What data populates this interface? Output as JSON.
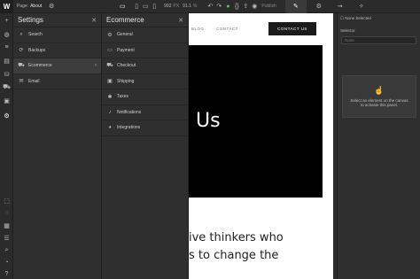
{
  "topbar": {
    "logo": "W",
    "page_prefix": "Page:",
    "page_name": "About",
    "width": "992",
    "px": "PX",
    "zoom": "91.1",
    "percent": "%",
    "publish_label": "Publish"
  },
  "settings_panel": {
    "title": "Settings",
    "items": [
      {
        "label": "Search",
        "icon": "search-icon"
      },
      {
        "label": "Backups",
        "icon": "backups-icon"
      },
      {
        "label": "Ecommerce",
        "icon": "cart-icon"
      },
      {
        "label": "Email",
        "icon": "email-icon"
      }
    ]
  },
  "ecommerce_panel": {
    "title": "Ecommerce",
    "items": [
      {
        "label": "General",
        "icon": "gear-icon"
      },
      {
        "label": "Payment",
        "icon": "payment-icon"
      },
      {
        "label": "Checkout",
        "icon": "checkout-icon"
      },
      {
        "label": "Shipping",
        "icon": "shipping-icon"
      },
      {
        "label": "Taxes",
        "icon": "taxes-icon"
      },
      {
        "label": "Notifications",
        "icon": "bell-icon"
      },
      {
        "label": "Integrations",
        "icon": "integrations-icon"
      }
    ]
  },
  "canvas": {
    "nav_blog": "BLOG",
    "nav_contact": "CONTACT",
    "cta": "CONTACT US",
    "hero_title": "Us",
    "tagline_line1": "ive thinkers who",
    "tagline_line2": "s to change the"
  },
  "right_panel": {
    "status": "None Selected",
    "selector_label": "Selector",
    "selector_placeholder": "None",
    "empty_line1": "Select an element on the canvas",
    "empty_line2": "to activate this panel."
  }
}
